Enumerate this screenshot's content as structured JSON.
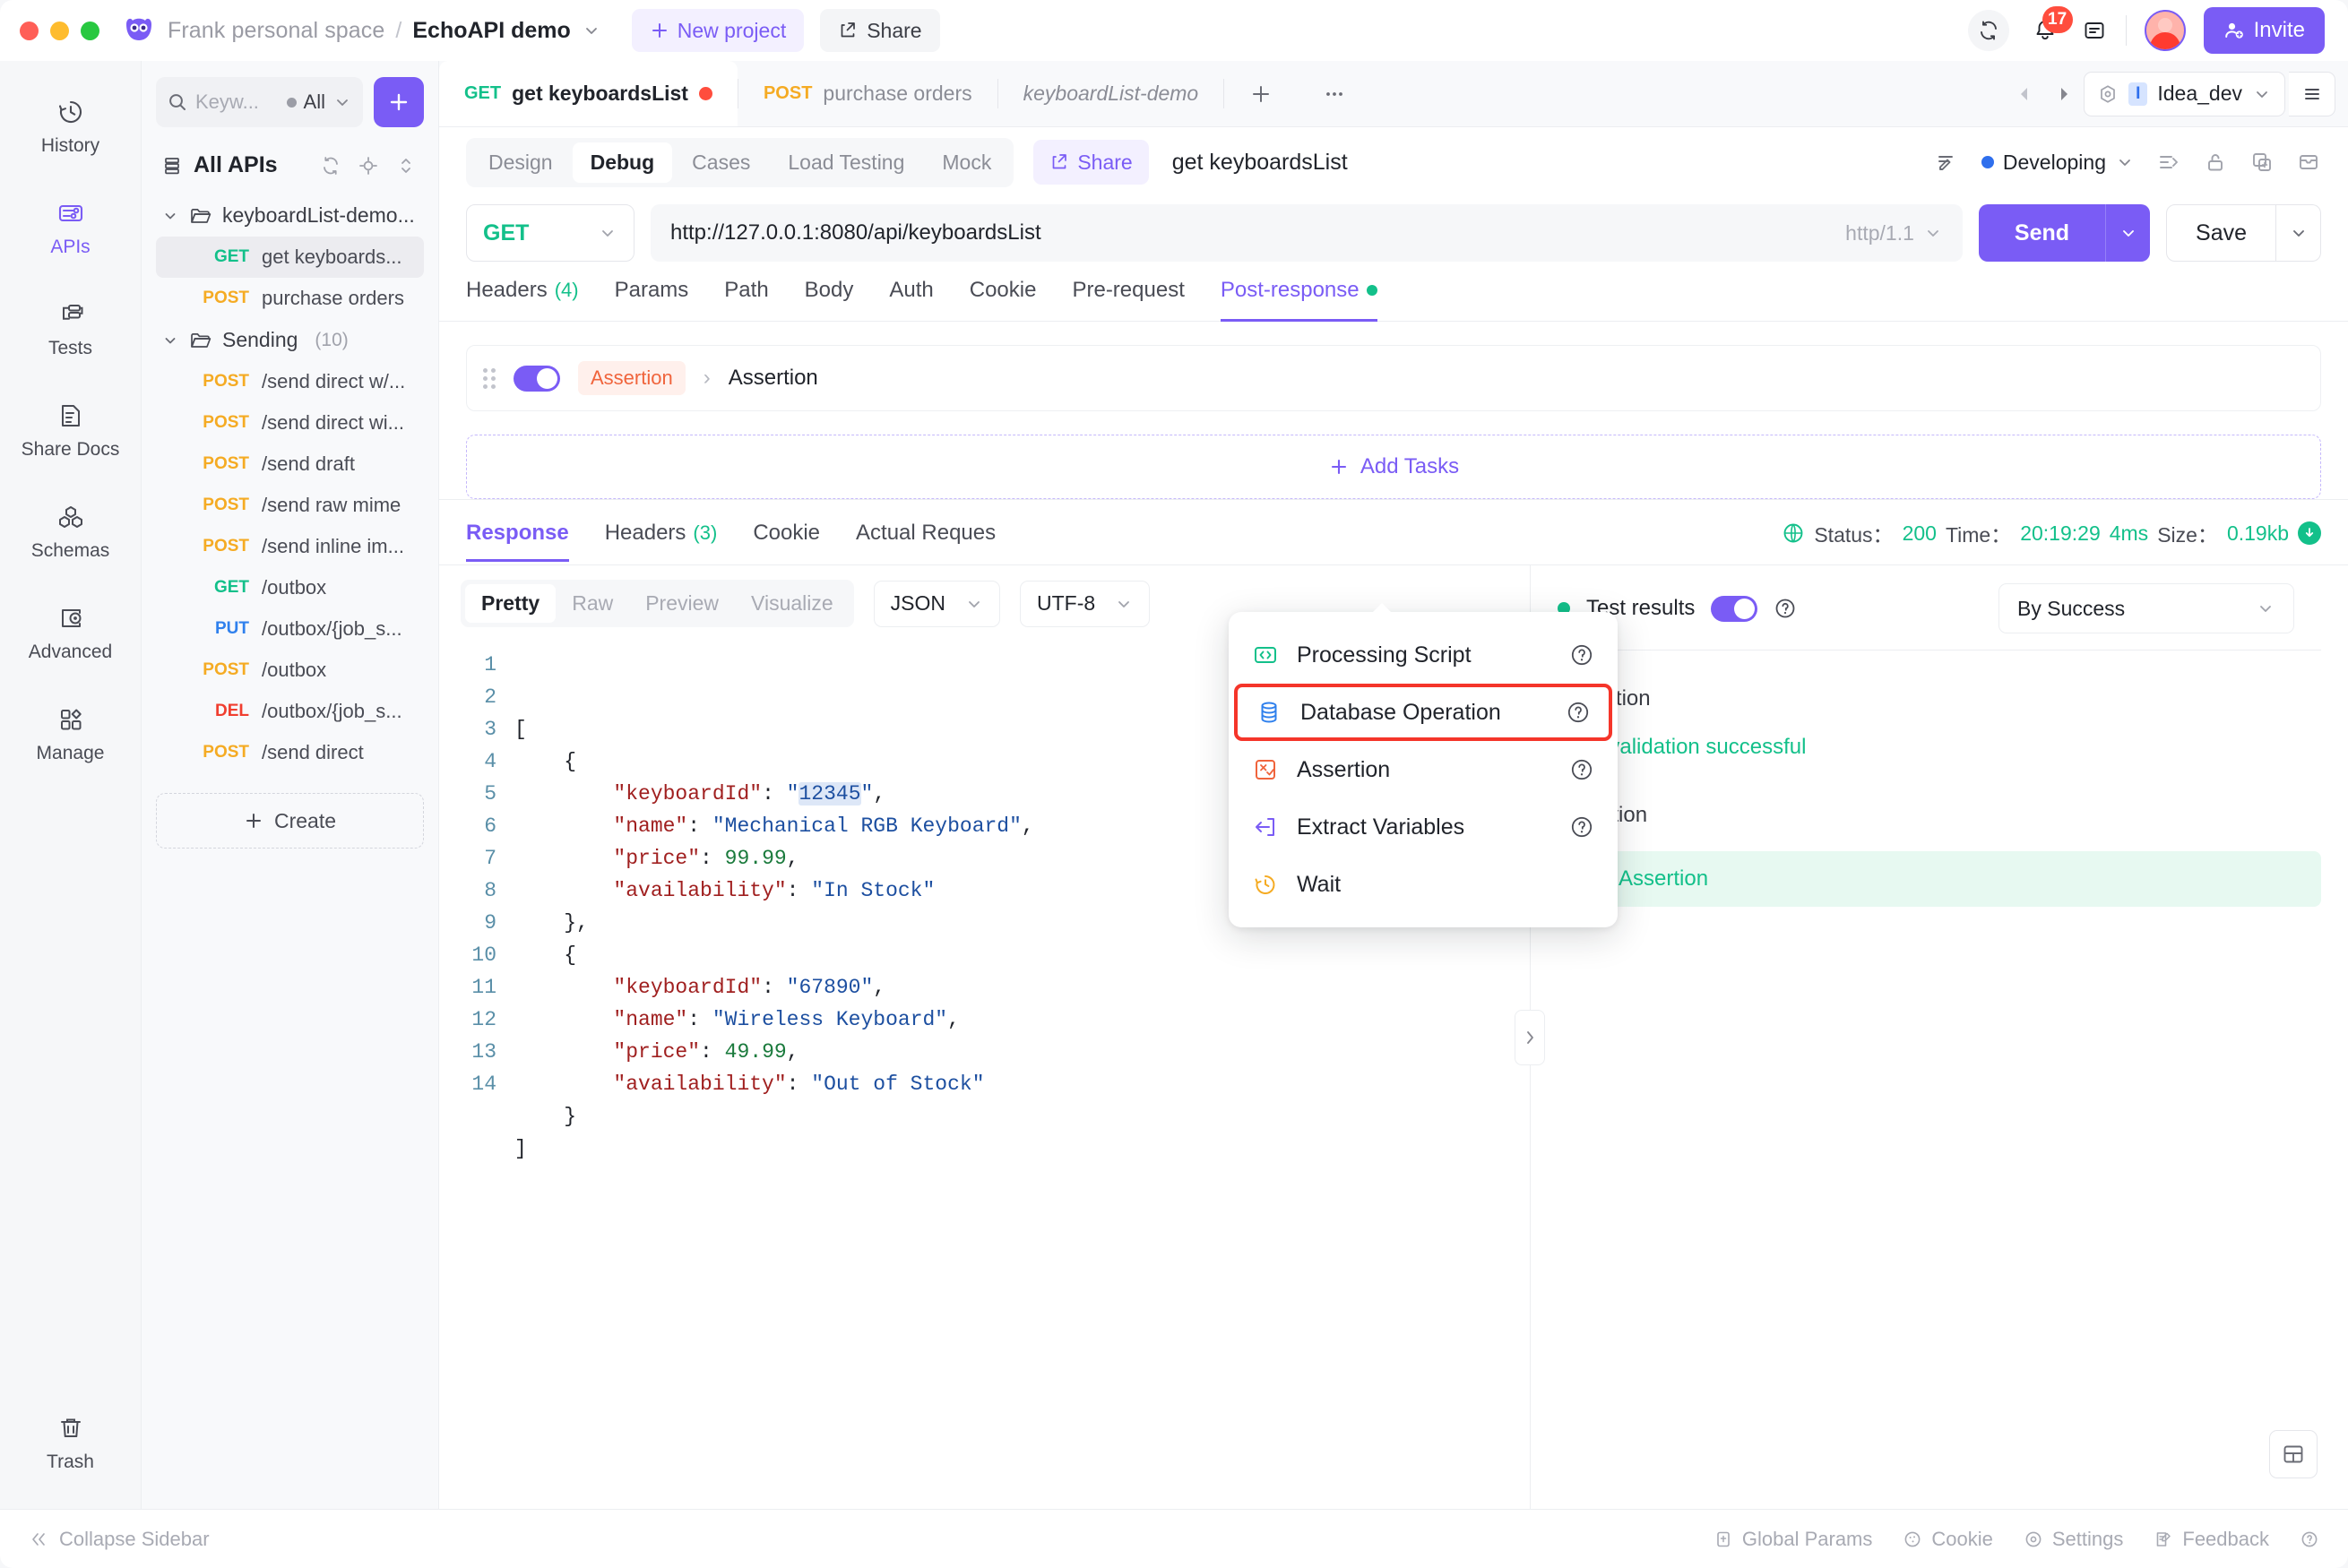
{
  "titlebar": {
    "workspace": "Frank personal space",
    "separator": "/",
    "project": "EchoAPI demo",
    "new_project": "New project",
    "share": "Share",
    "notification_count": "17",
    "invite": "Invite"
  },
  "rail": {
    "items": [
      {
        "label": "History",
        "icon": "history-icon",
        "active": false
      },
      {
        "label": "APIs",
        "icon": "apis-icon",
        "active": true
      },
      {
        "label": "Tests",
        "icon": "tests-icon",
        "active": false
      },
      {
        "label": "Share Docs",
        "icon": "share-docs-icon",
        "active": false
      },
      {
        "label": "Schemas",
        "icon": "schemas-icon",
        "active": false
      },
      {
        "label": "Advanced",
        "icon": "advanced-icon",
        "active": false
      },
      {
        "label": "Manage",
        "icon": "manage-icon",
        "active": false
      }
    ],
    "trash": "Trash"
  },
  "tree": {
    "search_placeholder": "Keyw...",
    "filter_label": "All",
    "all_apis": "All APIs",
    "folders": [
      {
        "name": "keyboardList-demo...",
        "count": ""
      },
      {
        "name": "Sending",
        "count": "(10)"
      }
    ],
    "items_group1": [
      {
        "method": "GET",
        "name": "get keyboards...",
        "selected": true
      },
      {
        "method": "POST",
        "name": "purchase orders",
        "selected": false
      }
    ],
    "items_group2": [
      {
        "method": "POST",
        "name": "/send direct w/..."
      },
      {
        "method": "POST",
        "name": "/send direct wi..."
      },
      {
        "method": "POST",
        "name": "/send draft"
      },
      {
        "method": "POST",
        "name": "/send raw mime"
      },
      {
        "method": "POST",
        "name": "/send inline im..."
      },
      {
        "method": "GET",
        "name": "/outbox"
      },
      {
        "method": "PUT",
        "name": "/outbox/{job_s..."
      },
      {
        "method": "POST",
        "name": "/outbox"
      },
      {
        "method": "DEL",
        "name": "/outbox/{job_s..."
      },
      {
        "method": "POST",
        "name": "/send direct"
      }
    ],
    "create": "Create"
  },
  "tabbar": {
    "tabs": [
      {
        "method": "GET",
        "name": "get keyboardsList",
        "active": true,
        "dirty": true,
        "italic": false
      },
      {
        "method": "POST",
        "name": "purchase orders",
        "active": false,
        "dirty": false,
        "italic": false
      },
      {
        "method": "",
        "name": "keyboardList-demo",
        "active": false,
        "dirty": false,
        "italic": true
      }
    ],
    "env_badge": "I",
    "env_name": "Idea_dev"
  },
  "subtabs": {
    "items": [
      {
        "label": "Design",
        "active": false
      },
      {
        "label": "Debug",
        "active": true
      },
      {
        "label": "Cases",
        "active": false
      },
      {
        "label": "Load Testing",
        "active": false
      },
      {
        "label": "Mock",
        "active": false
      }
    ],
    "share": "Share",
    "request_title": "get keyboardsList",
    "status": "Developing"
  },
  "urlrow": {
    "method": "GET",
    "url": "http://127.0.0.1:8080/api/keyboardsList",
    "protocol": "http/1.1",
    "send": "Send",
    "save": "Save"
  },
  "reqtabs": [
    {
      "label": "Headers",
      "count": "(4)",
      "active": false,
      "dot": false
    },
    {
      "label": "Params",
      "count": "",
      "active": false,
      "dot": false
    },
    {
      "label": "Path",
      "count": "",
      "active": false,
      "dot": false
    },
    {
      "label": "Body",
      "count": "",
      "active": false,
      "dot": false
    },
    {
      "label": "Auth",
      "count": "",
      "active": false,
      "dot": false
    },
    {
      "label": "Cookie",
      "count": "",
      "active": false,
      "dot": false
    },
    {
      "label": "Pre-request",
      "count": "",
      "active": false,
      "dot": false
    },
    {
      "label": "Post-response",
      "count": "",
      "active": true,
      "dot": true
    }
  ],
  "assertion_strip": {
    "chip": "Assertion",
    "name": "Assertion"
  },
  "add_tasks": "Add Tasks",
  "menu": {
    "items": [
      {
        "label": "Processing Script",
        "icon": "code-brackets-icon",
        "highlight": false
      },
      {
        "label": "Database Operation",
        "icon": "database-icon",
        "highlight": true
      },
      {
        "label": "Assertion",
        "icon": "assertion-icon",
        "highlight": false
      },
      {
        "label": "Extract Variables",
        "icon": "extract-variables-icon",
        "highlight": false
      },
      {
        "label": "Wait",
        "icon": "wait-clock-icon",
        "highlight": false
      }
    ]
  },
  "response": {
    "tabs": [
      {
        "label": "Response",
        "count": "",
        "active": true
      },
      {
        "label": "Headers",
        "count": "(3)",
        "active": false
      },
      {
        "label": "Cookie",
        "count": "",
        "active": false
      },
      {
        "label": "Actual Reques",
        "count": "",
        "active": false
      }
    ],
    "status_label": "Status：",
    "status_value": "200",
    "time_label": "Time：",
    "time_value": "20:19:29",
    "time_ms": "4ms",
    "size_label": "Size：",
    "size_value": "0.19kb",
    "formats": [
      {
        "label": "Pretty",
        "active": true
      },
      {
        "label": "Raw",
        "active": false
      },
      {
        "label": "Preview",
        "active": false
      },
      {
        "label": "Visualize",
        "active": false
      }
    ],
    "content_type": "JSON",
    "encoding": "UTF-8",
    "code_lines": [
      {
        "n": "1",
        "tokens": [
          {
            "t": "[",
            "c": "p"
          }
        ]
      },
      {
        "n": "2",
        "tokens": [
          {
            "t": "    {",
            "c": "p"
          }
        ]
      },
      {
        "n": "3",
        "tokens": [
          {
            "t": "        ",
            "c": "p"
          },
          {
            "t": "\"keyboardId\"",
            "c": "k"
          },
          {
            "t": ": ",
            "c": "p"
          },
          {
            "t": "\"",
            "c": "s"
          },
          {
            "t": "12345",
            "c": "s hl"
          },
          {
            "t": "\"",
            "c": "s"
          },
          {
            "t": ",",
            "c": "p"
          }
        ]
      },
      {
        "n": "4",
        "tokens": [
          {
            "t": "        ",
            "c": "p"
          },
          {
            "t": "\"name\"",
            "c": "k"
          },
          {
            "t": ": ",
            "c": "p"
          },
          {
            "t": "\"Mechanical RGB Keyboard\"",
            "c": "s"
          },
          {
            "t": ",",
            "c": "p"
          }
        ]
      },
      {
        "n": "5",
        "tokens": [
          {
            "t": "        ",
            "c": "p"
          },
          {
            "t": "\"price\"",
            "c": "k"
          },
          {
            "t": ": ",
            "c": "p"
          },
          {
            "t": "99.99",
            "c": "n"
          },
          {
            "t": ",",
            "c": "p"
          }
        ]
      },
      {
        "n": "6",
        "tokens": [
          {
            "t": "        ",
            "c": "p"
          },
          {
            "t": "\"availability\"",
            "c": "k"
          },
          {
            "t": ": ",
            "c": "p"
          },
          {
            "t": "\"In Stock\"",
            "c": "s"
          }
        ]
      },
      {
        "n": "7",
        "tokens": [
          {
            "t": "    },",
            "c": "p"
          }
        ]
      },
      {
        "n": "8",
        "tokens": [
          {
            "t": "    {",
            "c": "p"
          }
        ]
      },
      {
        "n": "9",
        "tokens": [
          {
            "t": "        ",
            "c": "p"
          },
          {
            "t": "\"keyboardId\"",
            "c": "k"
          },
          {
            "t": ": ",
            "c": "p"
          },
          {
            "t": "\"67890\"",
            "c": "s"
          },
          {
            "t": ",",
            "c": "p"
          }
        ]
      },
      {
        "n": "10",
        "tokens": [
          {
            "t": "        ",
            "c": "p"
          },
          {
            "t": "\"name\"",
            "c": "k"
          },
          {
            "t": ": ",
            "c": "p"
          },
          {
            "t": "\"Wireless Keyboard\"",
            "c": "s"
          },
          {
            "t": ",",
            "c": "p"
          }
        ]
      },
      {
        "n": "11",
        "tokens": [
          {
            "t": "        ",
            "c": "p"
          },
          {
            "t": "\"price\"",
            "c": "k"
          },
          {
            "t": ": ",
            "c": "p"
          },
          {
            "t": "49.99",
            "c": "n"
          },
          {
            "t": ",",
            "c": "p"
          }
        ]
      },
      {
        "n": "12",
        "tokens": [
          {
            "t": "        ",
            "c": "p"
          },
          {
            "t": "\"availability\"",
            "c": "k"
          },
          {
            "t": ": ",
            "c": "p"
          },
          {
            "t": "\"Out of Stock\"",
            "c": "s"
          }
        ]
      },
      {
        "n": "13",
        "tokens": [
          {
            "t": "    }",
            "c": "p"
          }
        ]
      },
      {
        "n": "14",
        "tokens": [
          {
            "t": "]",
            "c": "p"
          }
        ]
      }
    ]
  },
  "test_results": {
    "title": "Test results",
    "filter": "By Success",
    "validation_label": "Validation",
    "validation_text": "Data validation successful",
    "assertion_label": "Assertion",
    "assertion_item": "Assertion"
  },
  "footer": {
    "collapse": "Collapse Sidebar",
    "items": [
      {
        "label": "Global Params",
        "icon": "global-params-icon"
      },
      {
        "label": "Cookie",
        "icon": "cookie-icon"
      },
      {
        "label": "Settings",
        "icon": "settings-gear-icon"
      },
      {
        "label": "Feedback",
        "icon": "feedback-icon"
      }
    ]
  },
  "colors": {
    "accent": "#7a5cf5",
    "get": "#13c08a",
    "post": "#f5ab23",
    "put": "#2f80ed",
    "del": "#f03e2f",
    "highlight_border": "#f5352a"
  }
}
